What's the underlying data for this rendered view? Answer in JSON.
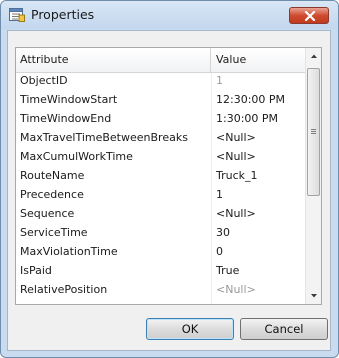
{
  "window": {
    "title": "Properties",
    "close_icon": "close-icon"
  },
  "grid": {
    "headers": {
      "attribute": "Attribute",
      "value": "Value"
    },
    "rows": [
      {
        "attribute": "ObjectID",
        "value": "1",
        "readonly": true
      },
      {
        "attribute": "TimeWindowStart",
        "value": "12:30:00 PM",
        "readonly": false
      },
      {
        "attribute": "TimeWindowEnd",
        "value": "1:30:00 PM",
        "readonly": false
      },
      {
        "attribute": "MaxTravelTimeBetweenBreaks",
        "value": "<Null>",
        "readonly": false
      },
      {
        "attribute": "MaxCumulWorkTime",
        "value": "<Null>",
        "readonly": false
      },
      {
        "attribute": "RouteName",
        "value": "Truck_1",
        "readonly": false
      },
      {
        "attribute": "Precedence",
        "value": "1",
        "readonly": false
      },
      {
        "attribute": "Sequence",
        "value": "<Null>",
        "readonly": false
      },
      {
        "attribute": "ServiceTime",
        "value": "30",
        "readonly": false
      },
      {
        "attribute": "MaxViolationTime",
        "value": "0",
        "readonly": false
      },
      {
        "attribute": "IsPaid",
        "value": "True",
        "readonly": false
      },
      {
        "attribute": "RelativePosition",
        "value": "<Null>",
        "readonly": true
      }
    ]
  },
  "buttons": {
    "ok": "OK",
    "cancel": "Cancel"
  },
  "colors": {
    "titlebar": "#c9dcef",
    "close": "#c9442a",
    "readonly_text": "#9a9a9a"
  }
}
